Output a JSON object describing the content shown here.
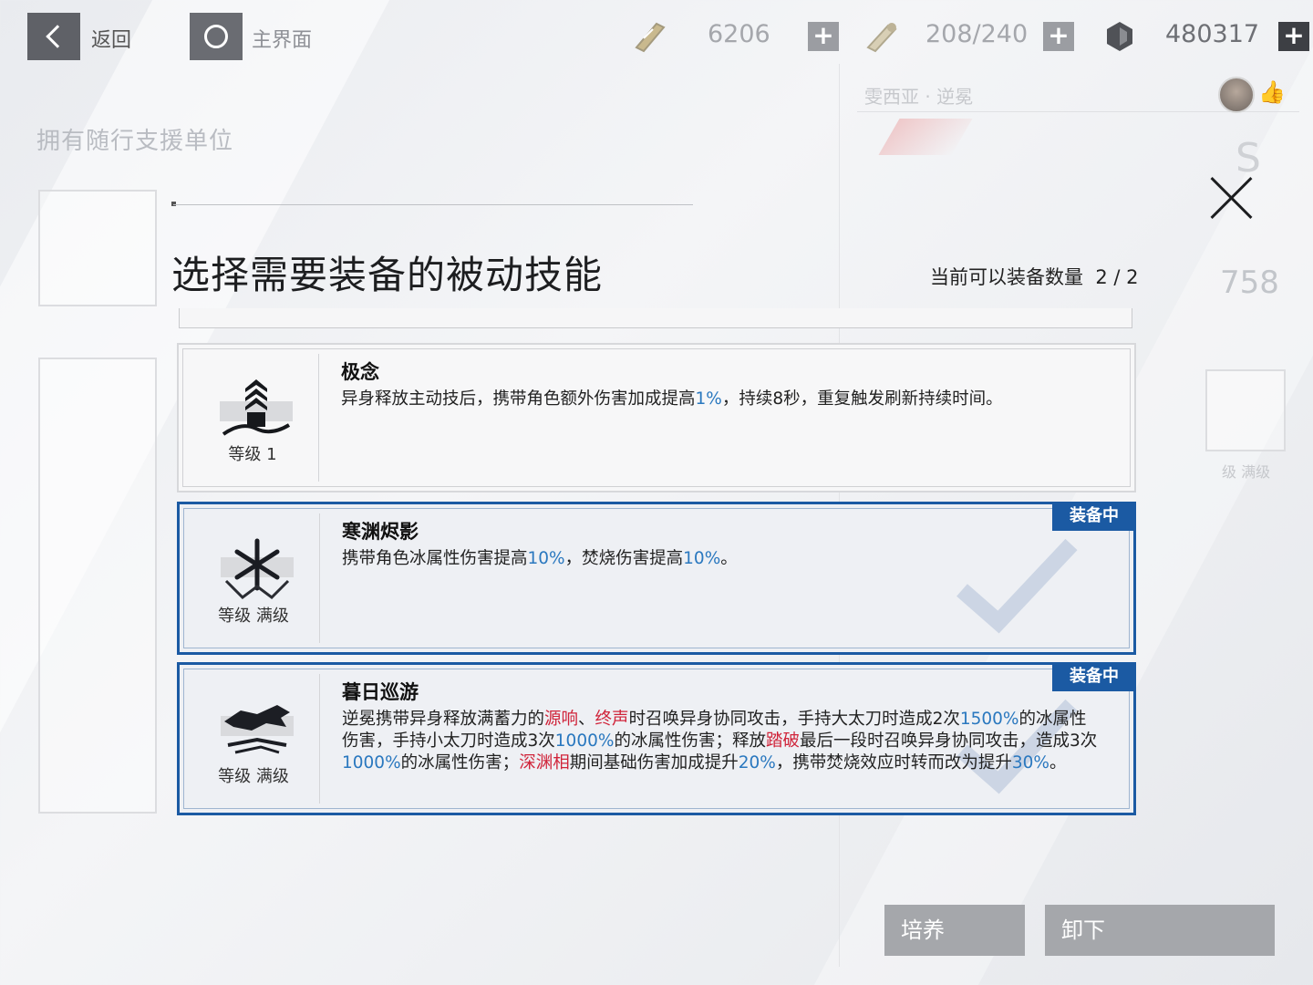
{
  "topbar": {
    "back_label": "返回",
    "home_label": "主界面",
    "resources": [
      {
        "icon": "ticket-icon",
        "value": "6206"
      },
      {
        "icon": "energy-icon",
        "value": "208/240"
      },
      {
        "icon": "crystal-icon",
        "value": "480317"
      }
    ]
  },
  "background": {
    "title": "拥有随行支援单位",
    "character_name": "雯西亚 · 逆冕",
    "rank": "S",
    "power": "758",
    "level_label": "级 满级"
  },
  "modal": {
    "title": "选择需要装备的被动技能",
    "count_label": "当前可以装备数量",
    "count_value": "2 / 2"
  },
  "skills": [
    {
      "name": "极念",
      "level": "等级 1",
      "equipped": false,
      "desc": [
        {
          "t": "异身释放主动技后，携带角色额外伤害加成提高"
        },
        {
          "t": "1%",
          "c": "blue"
        },
        {
          "t": "，持续8秒，重复触发刷新持续时间。"
        }
      ]
    },
    {
      "name": "寒渊烬影",
      "level": "等级  满级",
      "equipped": true,
      "badge": "装备中",
      "desc": [
        {
          "t": "携带角色冰属性伤害提高"
        },
        {
          "t": "10%",
          "c": "blue"
        },
        {
          "t": "，焚烧伤害提高"
        },
        {
          "t": "10%",
          "c": "blue"
        },
        {
          "t": "。"
        }
      ]
    },
    {
      "name": "暮日巡游",
      "level": "等级  满级",
      "equipped": true,
      "badge": "装备中",
      "desc": [
        {
          "t": "逆冕携带异身释放满蓄力的"
        },
        {
          "t": "源响",
          "c": "red"
        },
        {
          "t": "、"
        },
        {
          "t": "终声",
          "c": "red"
        },
        {
          "t": "时召唤异身协同攻击，手持大太刀时造成2次"
        },
        {
          "t": "1500%",
          "c": "blue"
        },
        {
          "t": "的冰属性伤害，手持小太刀时造成3次"
        },
        {
          "t": "1000%",
          "c": "blue"
        },
        {
          "t": "的冰属性伤害；释放"
        },
        {
          "t": "踏破",
          "c": "red"
        },
        {
          "t": "最后一段时召唤异身协同攻击，造成3次"
        },
        {
          "t": "1000%",
          "c": "blue"
        },
        {
          "t": "的冰属性伤害；"
        },
        {
          "t": "深渊相",
          "c": "red"
        },
        {
          "t": "期间基础伤害加成提升"
        },
        {
          "t": "20%",
          "c": "blue"
        },
        {
          "t": "，携带焚烧效应时转而改为提升"
        },
        {
          "t": "30%",
          "c": "blue"
        },
        {
          "t": "。"
        }
      ]
    }
  ],
  "bottom": {
    "train_label": "培养",
    "unequip_label": "卸下"
  },
  "colors": {
    "accent": "#1b5aa3",
    "highlight_blue": "#2a78bf",
    "highlight_red": "#d0243a"
  }
}
